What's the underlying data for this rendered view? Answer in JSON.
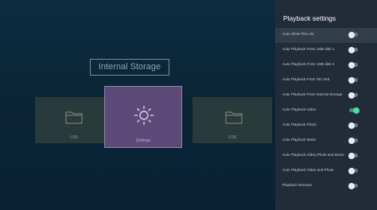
{
  "main": {
    "storage_title": "Internal Storage",
    "tiles": {
      "left_label": "USB",
      "center_label": "Settings",
      "right_label": "USB"
    }
  },
  "panel": {
    "title": "Playback settings",
    "items": [
      {
        "label": "Auto Show File List",
        "on": false
      },
      {
        "label": "Auto Playback From USB disk 1",
        "on": false
      },
      {
        "label": "Auto Playback From USB disk 2",
        "on": false
      },
      {
        "label": "Auto Playback From SD card",
        "on": false
      },
      {
        "label": "Auto Playback From Internal Storage",
        "on": false
      },
      {
        "label": "Auto Playback Video",
        "on": true
      },
      {
        "label": "Auto Playback Photo",
        "on": false
      },
      {
        "label": "Auto Playback Music",
        "on": false
      },
      {
        "label": "Auto Playback Video,Photo and Music",
        "on": false
      },
      {
        "label": "Auto Playback Video and Photo",
        "on": false
      },
      {
        "label": "Playback Resume",
        "on": false
      }
    ]
  },
  "colors": {
    "toggle_on": "#46e0a3",
    "panel_bg": "#222c38",
    "selected_tile": "#5e4a78"
  }
}
